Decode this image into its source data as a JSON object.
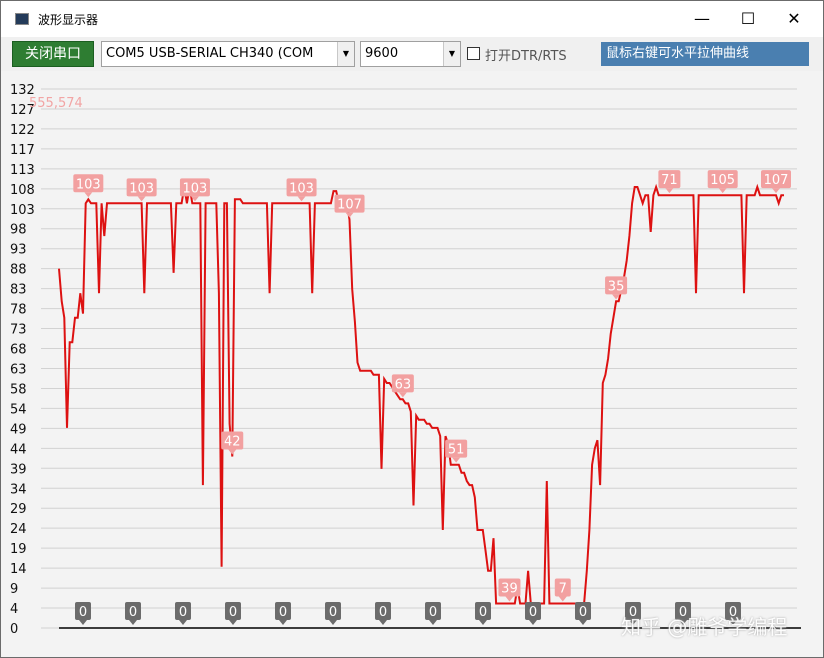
{
  "window": {
    "title": "波形显示器",
    "minimize_glyph": "—",
    "maximize_glyph": "☐",
    "close_glyph": "✕"
  },
  "toolbar": {
    "close_port_label": "关闭串口",
    "port_value": "COM5 USB-SERIAL CH340 (COM",
    "baud_value": "9600",
    "dtr_label": "打开DTR/RTS",
    "hint_text": "鼠标右键可水平拉伸曲线"
  },
  "cursor_readout": "555,574",
  "watermark": "知乎 @雕爷学编程",
  "colors": {
    "line": "#dd1111",
    "label_bg": "#f2a0a0",
    "zero_label_bg": "#6b6b6b",
    "accent": "#2e7d32"
  },
  "chart_data": {
    "type": "line",
    "y_ticks": [
      "132",
      "127",
      "122",
      "117",
      "113",
      "108",
      "103",
      "98",
      "93",
      "88",
      "83",
      "78",
      "73",
      "68",
      "63",
      "58",
      "54",
      "49",
      "44",
      "39",
      "34",
      "29",
      "24",
      "19",
      "14",
      "9",
      "4",
      "0"
    ],
    "ylim": [
      0,
      132
    ],
    "grid": true,
    "series": [
      {
        "values": [
          88,
          80,
          76,
          49,
          70,
          70,
          76,
          76,
          82,
          77,
          104,
          105,
          104,
          104,
          104,
          82,
          104,
          96,
          104,
          104,
          104,
          104,
          104,
          104,
          104,
          104,
          104,
          104,
          104,
          104,
          104,
          104,
          82,
          104,
          104,
          104,
          104,
          104,
          104,
          104,
          104,
          104,
          104,
          87,
          104,
          104,
          104,
          108,
          104,
          108,
          104,
          104,
          104,
          104,
          35,
          104,
          104,
          104,
          104,
          104,
          82,
          15,
          104,
          104,
          50,
          42,
          105,
          105,
          105,
          104,
          104,
          104,
          104,
          104,
          104,
          104,
          104,
          104,
          104,
          82,
          104,
          104,
          104,
          104,
          104,
          104,
          104,
          104,
          104,
          104,
          104,
          104,
          104,
          104,
          104,
          82,
          104,
          104,
          104,
          104,
          104,
          104,
          104,
          107,
          107,
          104,
          104,
          104,
          104,
          100,
          83,
          75,
          65,
          63,
          63,
          63,
          63,
          63,
          62,
          62,
          62,
          39,
          61,
          60,
          60,
          59,
          58,
          57,
          56,
          56,
          55,
          55,
          53,
          30,
          52,
          51,
          51,
          51,
          50,
          50,
          49,
          49,
          49,
          47,
          24,
          47,
          45,
          40,
          40,
          40,
          40,
          38,
          38,
          36,
          35,
          35,
          32,
          24,
          24,
          24,
          19,
          14,
          14,
          22,
          6,
          6,
          6,
          6,
          6,
          6,
          6,
          6,
          10,
          6,
          6,
          6,
          14,
          6,
          6,
          6,
          6,
          6,
          6,
          36,
          6,
          6,
          6,
          6,
          6,
          6,
          6,
          6,
          6,
          6,
          6,
          6,
          6,
          6,
          14,
          24,
          40,
          44,
          46,
          35,
          60,
          62,
          66,
          72,
          76,
          80,
          80,
          83,
          86,
          90,
          96,
          104,
          108,
          108,
          106,
          104,
          106,
          106,
          97,
          106,
          108,
          106,
          106,
          106,
          106,
          106,
          106,
          106,
          106,
          106,
          106,
          106,
          106,
          106,
          106,
          82,
          106,
          106,
          106,
          106,
          106,
          106,
          106,
          106,
          106,
          106,
          106,
          106,
          106,
          106,
          106,
          106,
          106,
          82,
          106,
          106,
          106,
          106,
          108,
          106,
          106,
          106,
          106,
          106,
          106,
          106,
          104,
          106,
          106
        ]
      }
    ],
    "value_labels": [
      {
        "i": 11,
        "text": "103"
      },
      {
        "i": 31,
        "text": "103"
      },
      {
        "i": 51,
        "text": "103"
      },
      {
        "i": 65,
        "text": "42"
      },
      {
        "i": 91,
        "text": "103"
      },
      {
        "i": 109,
        "text": "107"
      },
      {
        "i": 129,
        "text": "63"
      },
      {
        "i": 149,
        "text": "51"
      },
      {
        "i": 169,
        "text": "39"
      },
      {
        "i": 189,
        "text": "7"
      },
      {
        "i": 209,
        "text": "35"
      },
      {
        "i": 229,
        "text": "71"
      },
      {
        "i": 249,
        "text": "105"
      },
      {
        "i": 269,
        "text": "107"
      }
    ],
    "zero_labels": [
      "0",
      "0",
      "0",
      "0",
      "0",
      "0",
      "0",
      "0",
      "0",
      "0",
      "0",
      "0",
      "0",
      "0"
    ]
  }
}
